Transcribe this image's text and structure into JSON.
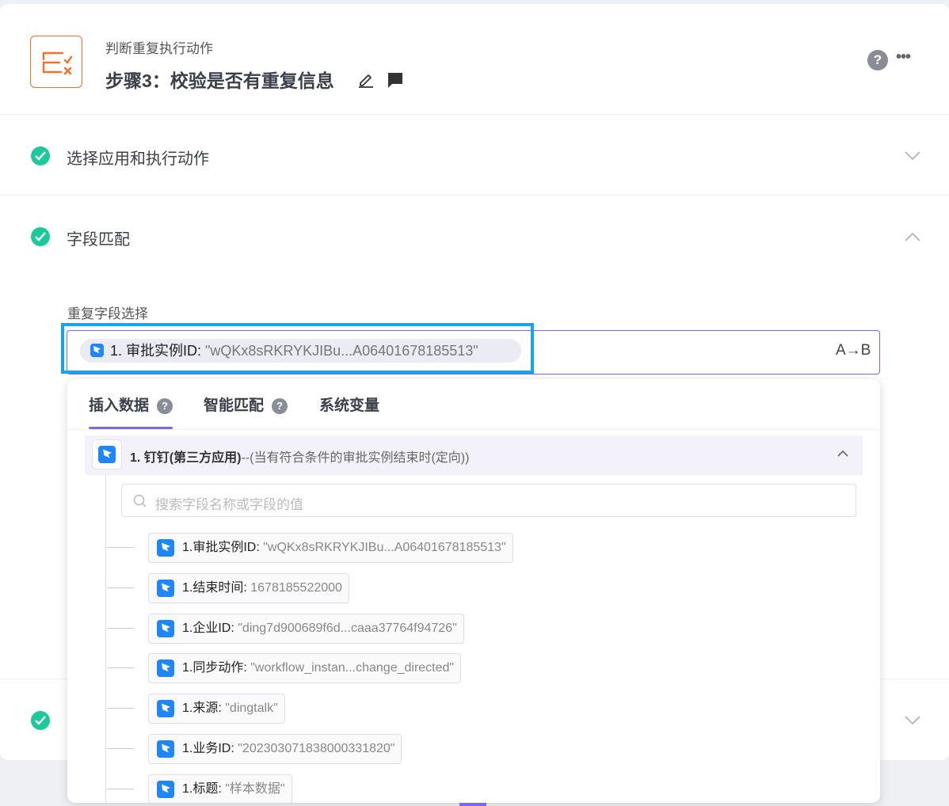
{
  "header": {
    "subtitle": "判断重复执行动作",
    "title": "步骤3：校验是否有重复信息",
    "help_label": "?",
    "more_label": "•••"
  },
  "sections": [
    {
      "label": "选择应用和执行动作",
      "expanded": false
    },
    {
      "label": "字段匹配",
      "expanded": true
    }
  ],
  "field": {
    "label": "重复字段选择",
    "token_key": "1. 审批实例ID: ",
    "token_value": "\"wQKx8sRKRYKJIBu...A06401678185513\"",
    "toggle_label": "A→B"
  },
  "panel": {
    "tabs": [
      {
        "label": "插入数据",
        "help": "?"
      },
      {
        "label": "智能匹配",
        "help": "?"
      },
      {
        "label": "系统变量"
      }
    ],
    "group": {
      "title": "1. 钉钉(第三方应用)",
      "desc": "--(当有符合条件的审批实例结束时(定向))"
    },
    "search_placeholder": "搜索字段名称或字段的值",
    "items": [
      {
        "key": "1.审批实例ID: ",
        "value": "\"wQKx8sRKRYKJIBu...A06401678185513\""
      },
      {
        "key": "1.结束时间: ",
        "value": "1678185522000"
      },
      {
        "key": "1.企业ID: ",
        "value": "\"ding7d900689f6d...caaa37764f94726\""
      },
      {
        "key": "1.同步动作: ",
        "value": "\"workflow_instan...change_directed\""
      },
      {
        "key": "1.来源: ",
        "value": "\"dingtalk\""
      },
      {
        "key": "1.业务ID: ",
        "value": "\"202303071838000331820\""
      },
      {
        "key": "1.标题: ",
        "value": "\"样本数据\""
      }
    ]
  },
  "colors": {
    "accent": "#7b68ee",
    "success": "#1cc99b",
    "dingtalk": "#1f86ff",
    "highlight": "#14a5f0",
    "app_icon": "#f0702e"
  }
}
